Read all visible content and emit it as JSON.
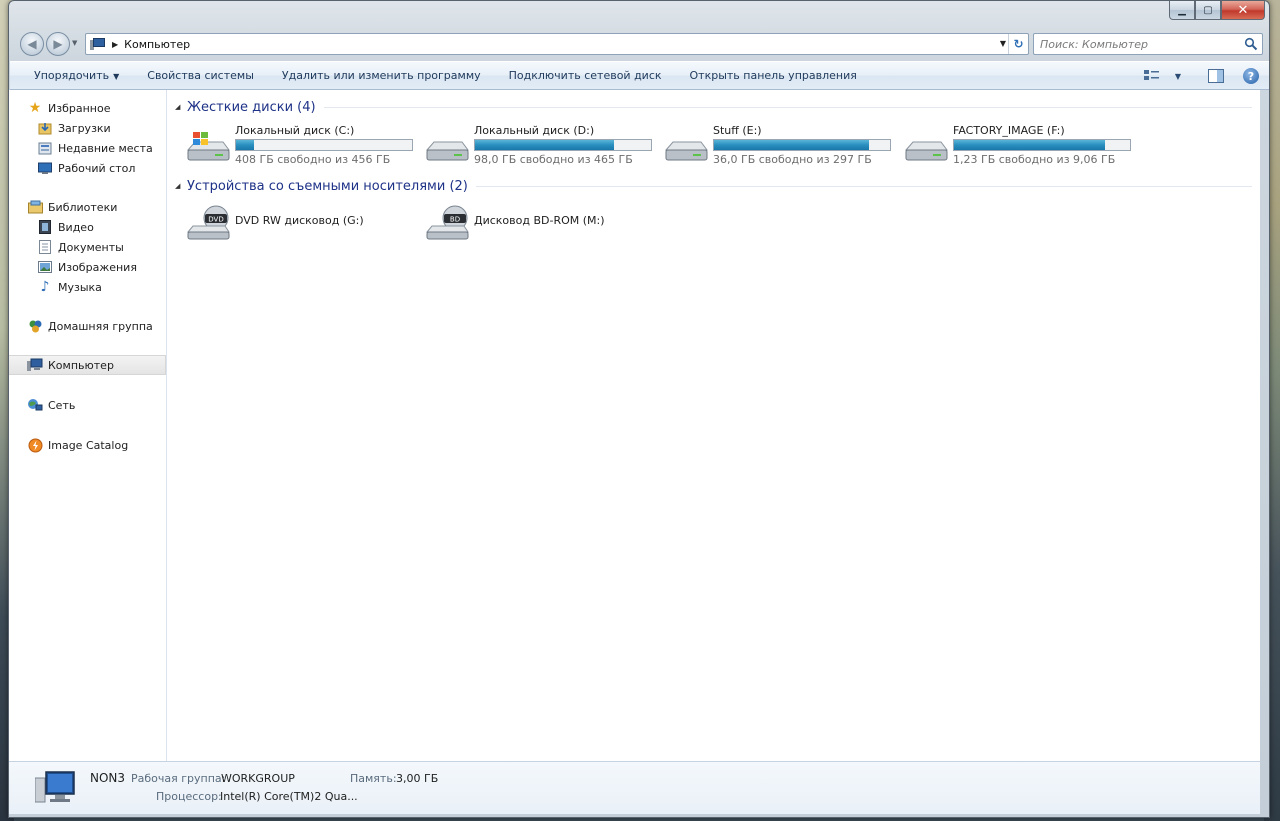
{
  "window": {
    "breadcrumb": "Компьютер",
    "search_placeholder": "Поиск: Компьютер"
  },
  "toolbar": {
    "organize": "Упорядочить",
    "system_properties": "Свойства системы",
    "uninstall": "Удалить или изменить программу",
    "map_drive": "Подключить сетевой диск",
    "control_panel": "Открыть панель управления"
  },
  "sidebar": {
    "favorites": "Избранное",
    "downloads": "Загрузки",
    "recent": "Недавние места",
    "desktop": "Рабочий стол",
    "libraries": "Библиотеки",
    "video": "Видео",
    "documents": "Документы",
    "pictures": "Изображения",
    "music": "Музыка",
    "homegroup": "Домашняя группа",
    "computer": "Компьютер",
    "network": "Сеть",
    "image_catalog": "Image Catalog"
  },
  "groups": {
    "hard_drives": "Жесткие диски (4)",
    "removable": "Устройства со съемными носителями (2)"
  },
  "drives": [
    {
      "name": "Локальный диск (C:)",
      "free": "408 ГБ свободно из 456 ГБ",
      "used_fraction": 0.105
    },
    {
      "name": "Локальный диск (D:)",
      "free": "98,0 ГБ свободно из 465 ГБ",
      "used_fraction": 0.79
    },
    {
      "name": "Stuff (E:)",
      "free": "36,0 ГБ свободно из 297 ГБ",
      "used_fraction": 0.88
    },
    {
      "name": "FACTORY_IMAGE (F:)",
      "free": "1,23 ГБ свободно из 9,06 ГБ",
      "used_fraction": 0.86
    }
  ],
  "optical": [
    {
      "name": "DVD RW дисковод (G:)",
      "badge": "DVD"
    },
    {
      "name": "Дисковод BD-ROM (M:)",
      "badge": "BD"
    }
  ],
  "details": {
    "computer_name": "NON3",
    "workgroup_label": "Рабочая группа:",
    "workgroup": "WORKGROUP",
    "memory_label": "Память:",
    "memory": "3,00 ГБ",
    "cpu_label": "Процессор:",
    "cpu": "Intel(R) Core(TM)2 Qua..."
  }
}
